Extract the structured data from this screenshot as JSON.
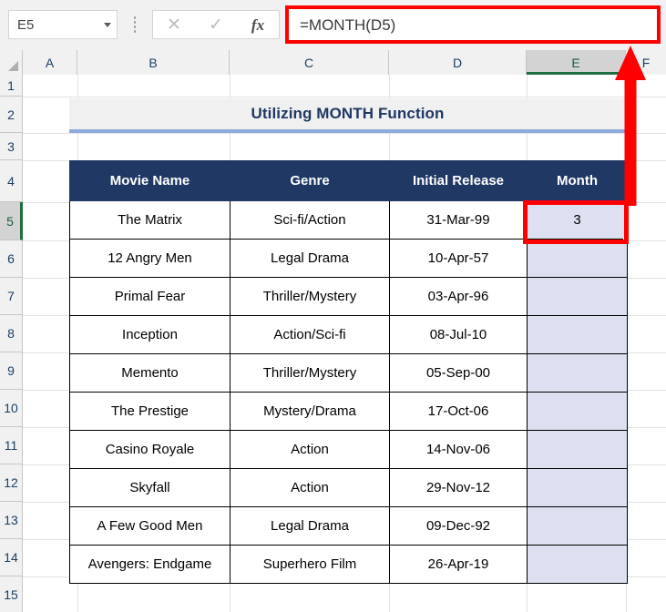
{
  "app": {
    "name_box_value": "E5",
    "formula_bar_value": "=MONTH(D5)",
    "cancel_icon": "close-icon",
    "confirm_icon": "check-icon",
    "function_icon": "fx-icon",
    "dropdown_icon": "chevron-down-icon"
  },
  "grid": {
    "column_headers": [
      "A",
      "B",
      "C",
      "D",
      "E",
      "F"
    ],
    "selected_column": "E",
    "row_headers": [
      "1",
      "2",
      "3",
      "4",
      "5",
      "6",
      "7",
      "8",
      "9",
      "10",
      "11",
      "12",
      "13",
      "14",
      "15"
    ],
    "selected_row": "5"
  },
  "sheet": {
    "title": "Utilizing MONTH Function",
    "table": {
      "headers": [
        "Movie Name",
        "Genre",
        "Initial Release",
        "Month"
      ],
      "rows": [
        {
          "movie": "The Matrix",
          "genre": "Sci-fi/Action",
          "release": "31-Mar-99",
          "month": "3"
        },
        {
          "movie": "12 Angry Men",
          "genre": "Legal Drama",
          "release": "10-Apr-57",
          "month": ""
        },
        {
          "movie": "Primal Fear",
          "genre": "Thriller/Mystery",
          "release": "03-Apr-96",
          "month": ""
        },
        {
          "movie": "Inception",
          "genre": "Action/Sci-fi",
          "release": "08-Jul-10",
          "month": ""
        },
        {
          "movie": "Memento",
          "genre": "Thriller/Mystery",
          "release": "05-Sep-00",
          "month": ""
        },
        {
          "movie": "The Prestige",
          "genre": "Mystery/Drama",
          "release": "17-Oct-06",
          "month": ""
        },
        {
          "movie": "Casino Royale",
          "genre": "Action",
          "release": "14-Nov-06",
          "month": ""
        },
        {
          "movie": "Skyfall",
          "genre": "Action",
          "release": "29-Nov-12",
          "month": ""
        },
        {
          "movie": "A Few Good Men",
          "genre": "Legal Drama",
          "release": "09-Dec-92",
          "month": ""
        },
        {
          "movie": "Avengers: Endgame",
          "genre": "Superhero Film",
          "release": "26-Apr-19",
          "month": ""
        }
      ]
    }
  },
  "annotations": {
    "highlight_color": "#ff0000",
    "formula_bar_box": "red-rectangle-around-formula-bar",
    "cell_box": "red-rectangle-around-cell-e5",
    "arrow": "red-arrow-from-cell-to-formula-bar"
  },
  "colors": {
    "header_fill": "#1f3864",
    "header_text": "#ffffff",
    "month_column_fill": "#dce0f0",
    "title_fill": "#f0f0f0",
    "title_text": "#1f3864",
    "title_underline": "#8faadc",
    "selection_green": "#1d6f42"
  }
}
